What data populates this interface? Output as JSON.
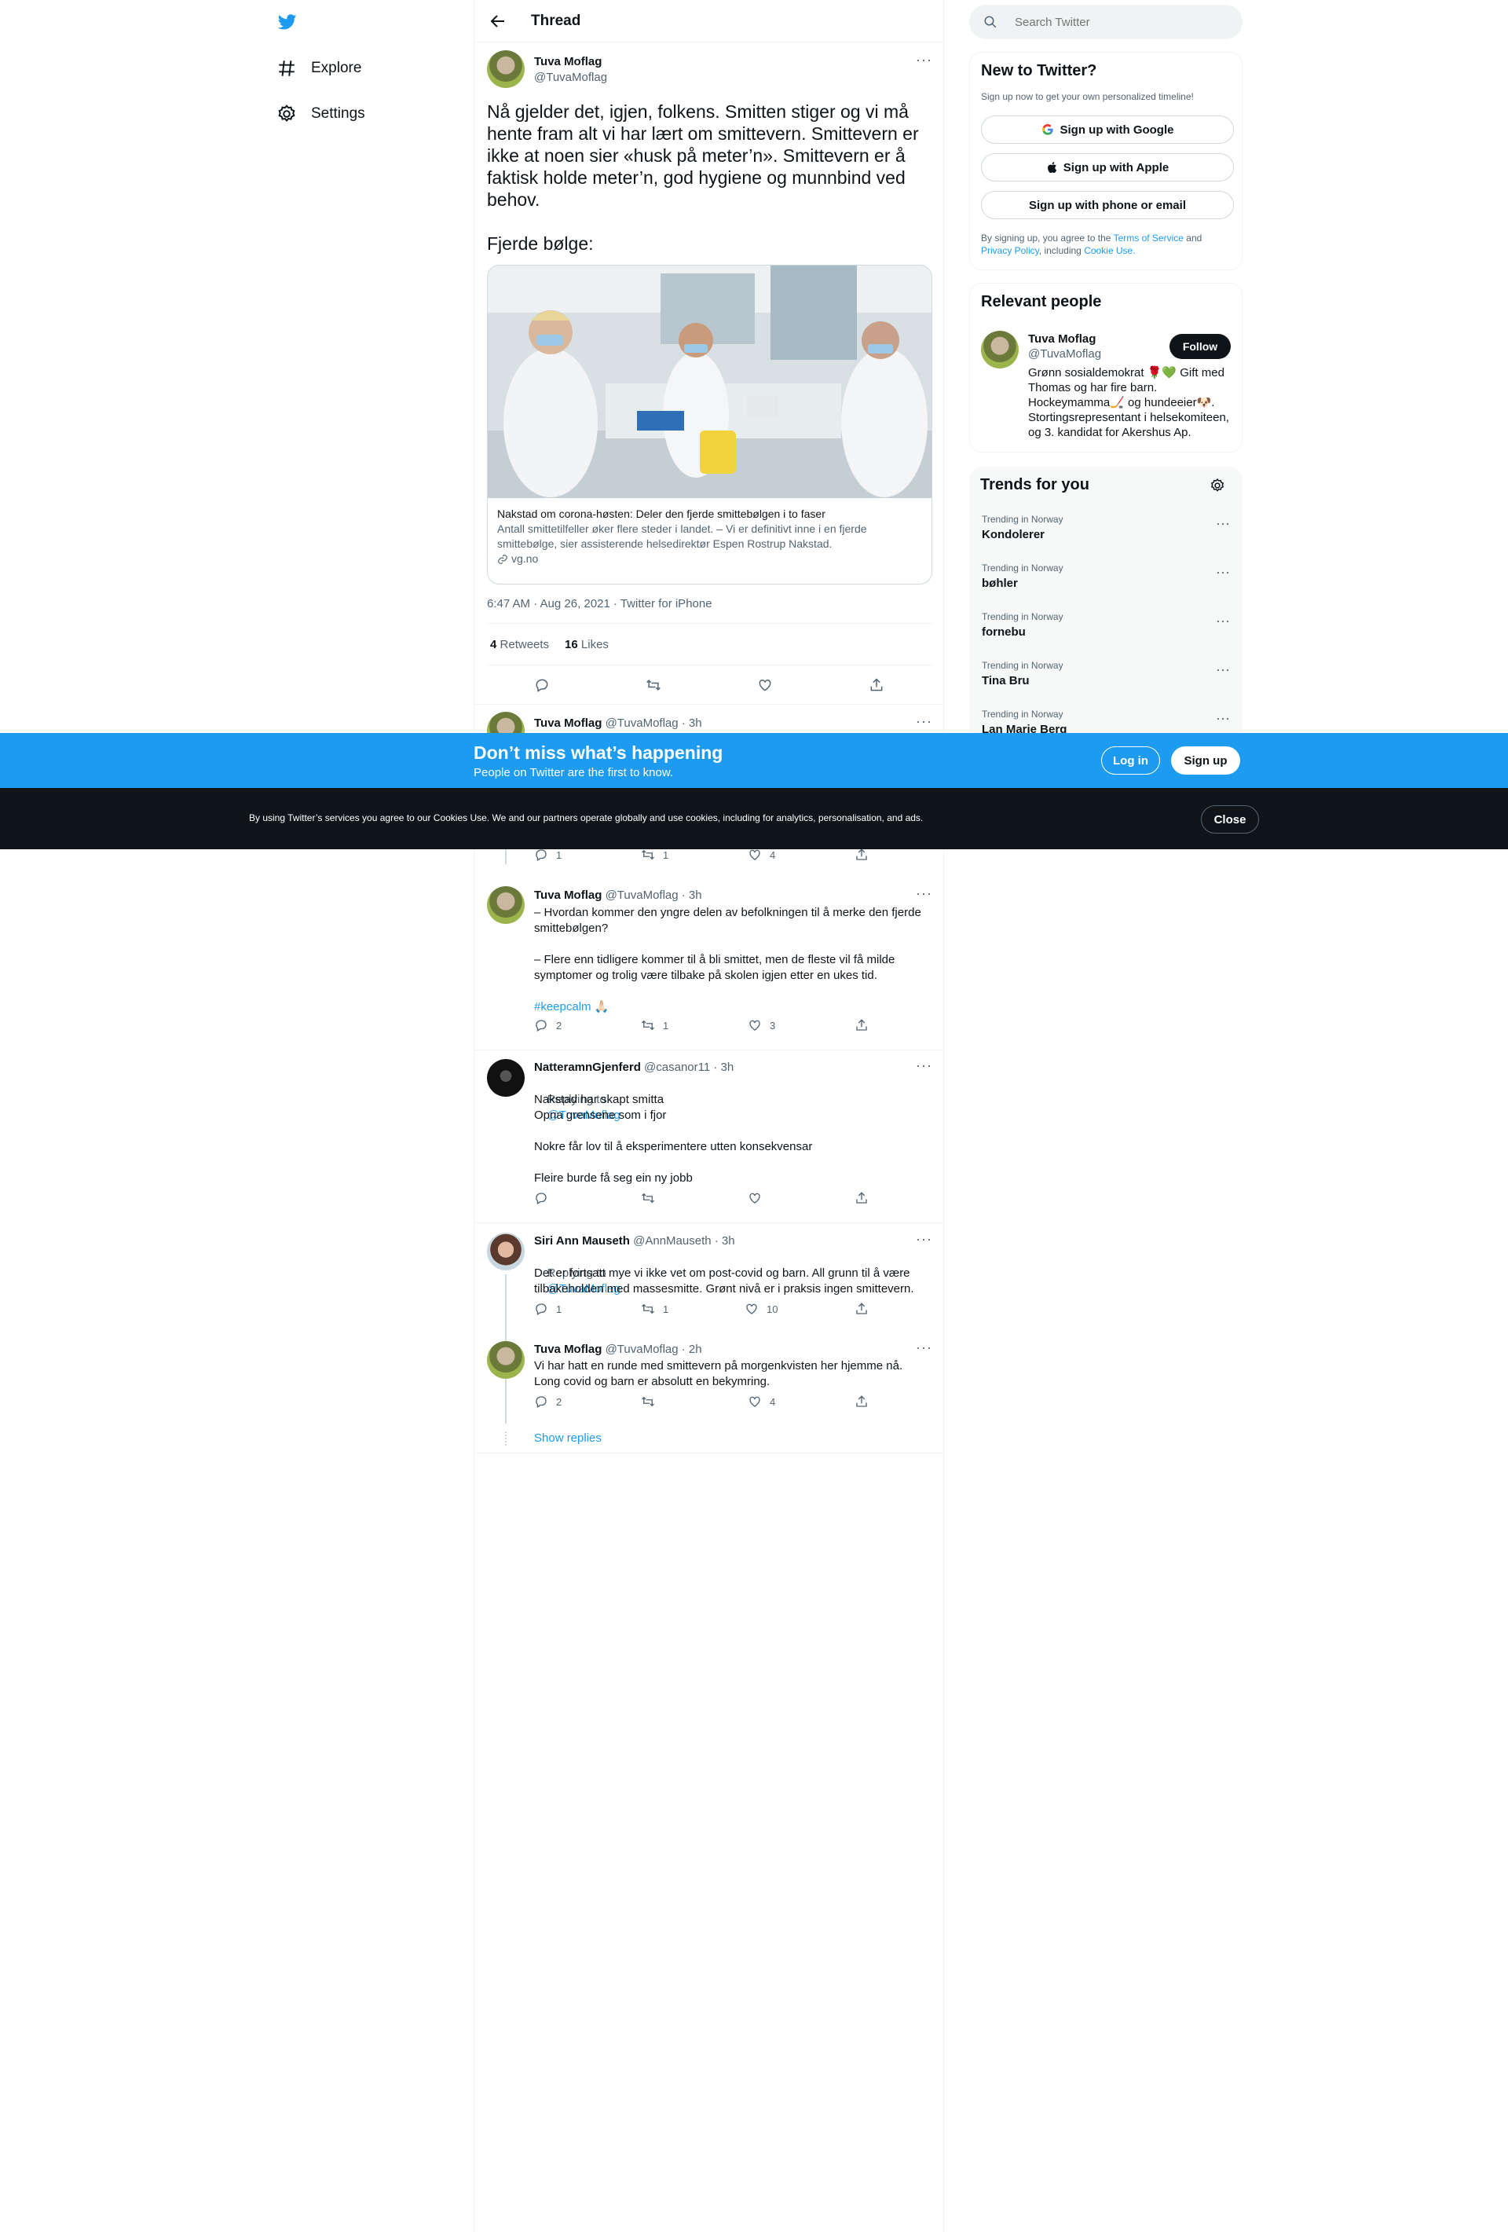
{
  "nav": {
    "explore": "Explore",
    "settings": "Settings"
  },
  "header": {
    "back_icon": "arrow-left-icon",
    "title": "Thread"
  },
  "tweet": {
    "name": "Tuva Moflag",
    "handle": "@TuvaMoflag",
    "text": "Nå gjelder det, igjen, folkens. Smitten stiger og vi må hente fram alt vi har lært om smittevern. Smittevern er ikke at noen sier «husk på meter’n». Smittevern er å faktisk holde meter’n, god hygiene og munnbind ved behov.\n\nFjerde bølge:",
    "card": {
      "title": "Nakstad om corona-høsten: Deler den fjerde smittebølgen i to faser",
      "description": "Antall smittetilfeller øker flere steder i landet. – Vi er definitivt inne i en fjerde smittebølge, sier assisterende helsedirektør Espen Rostrup Nakstad.",
      "domain": "vg.no"
    },
    "timestamp": "6:47 AM · Aug 26, 2021 · Twitter for iPhone",
    "retweets_count": "4",
    "retweets_label": "Retweets",
    "likes_count": "16",
    "likes_label": "Likes"
  },
  "replies": [
    {
      "name": "Tuva Moflag",
      "meta": "@TuvaMoflag · 3h",
      "counts": {
        "reply": "1",
        "retweet": "1",
        "like": "4"
      }
    },
    {
      "name": "Tuva Moflag",
      "meta": "@TuvaMoflag · 3h",
      "text": "– Hvordan kommer den yngre delen av befolkningen til å merke den fjerde smittebølgen?\n\n– Flere enn tidligere kommer til å bli smittet, men de fleste vil få milde symptomer og trolig være tilbake på skolen igjen etter en ukes tid.",
      "hashtag": "#keepcalm 🙏🏻",
      "counts": {
        "reply": "2",
        "retweet": "1",
        "like": "3"
      }
    },
    {
      "name": "NatteramnGjenferd",
      "meta": "@casanor11 · 3h",
      "replying_prefix": "Replying to",
      "replying_to": "@TuvaMoflag",
      "text": "Nakstad har skapt smitta\nOpna grensene som i fjor\n\nNokre får lov til å eksperimentere utten konsekvensar\n\nFleire burde få seg ein ny jobb",
      "counts": {
        "reply": "",
        "retweet": "",
        "like": ""
      }
    },
    {
      "name": "Siri Ann Mauseth",
      "meta": "@AnnMauseth · 3h",
      "replying_prefix": "Replying to",
      "replying_to": "@TuvaMoflag",
      "text": "Det er fortsatt mye vi ikke vet om post-covid og barn. All grunn til å være tilbakeholden med massesmitte. Grønt nivå er i praksis ingen smittevern.",
      "counts": {
        "reply": "1",
        "retweet": "1",
        "like": "10"
      }
    },
    {
      "name": "Tuva Moflag",
      "meta": "@TuvaMoflag · 2h",
      "text": "Vi har hatt en runde med smittevern på morgenkvisten her hjemme nå. Long covid og barn er absolutt en bekymring.",
      "counts": {
        "reply": "2",
        "retweet": "",
        "like": "4"
      }
    }
  ],
  "show_replies": "Show replies",
  "search": {
    "placeholder": "Search Twitter"
  },
  "new_to_twitter": {
    "title": "New to Twitter?",
    "subtitle": "Sign up now to get your own personalized timeline!",
    "google": "Sign up with Google",
    "apple": "Sign up with Apple",
    "phone": "Sign up with phone or email",
    "legal_prefix": "By signing up, you agree to the",
    "terms": "Terms of Service",
    "and": "and",
    "privacy": "Privacy Policy",
    "including": ", including",
    "cookie": "Cookie Use."
  },
  "relevant_people": {
    "title": "Relevant people",
    "name": "Tuva Moflag",
    "handle": "@TuvaMoflag",
    "follow": "Follow",
    "bio": "Grønn sosialdemokrat 🌹💚 Gift med Thomas og har fire barn. Hockeymamma🏒 og hundeeier🐶. Stortingsrepresentant i helsekomiteen, og 3. kandidat for Akershus Ap."
  },
  "trends": {
    "title": "Trends for you",
    "items": [
      {
        "category": "Trending in Norway",
        "name": "Kondolerer"
      },
      {
        "category": "Trending in Norway",
        "name": "bøhler"
      },
      {
        "category": "Trending in Norway",
        "name": "fornebu"
      },
      {
        "category": "Trending in Norway",
        "name": "Tina Bru"
      },
      {
        "category": "Trending in Norway",
        "name": "Lan Marie Berg"
      }
    ]
  },
  "banner": {
    "headline": "Don’t miss what’s happening",
    "subline": "People on Twitter are the first to know.",
    "login": "Log in",
    "signup": "Sign up"
  },
  "cookie": {
    "text": "By using Twitter’s services you agree to our Cookies Use. We and our partners operate globally and use cookies, including for analytics, personalisation, and ads.",
    "close": "Close"
  },
  "colors": {
    "brand": "#1d9bf0",
    "dark": "#0f1419",
    "muted": "#536471"
  }
}
